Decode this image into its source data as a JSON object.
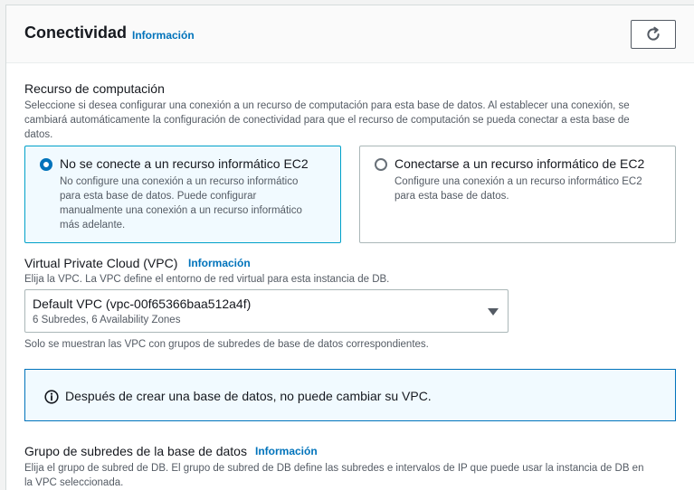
{
  "header": {
    "title": "Conectividad",
    "info_label": "Información",
    "refresh_icon": "refresh-icon"
  },
  "compute": {
    "label": "Recurso de computación",
    "description_lines": [
      "Seleccione si desea configurar una conexión a un recurso de computación para esta base de datos. Al establecer una conexión, se",
      "cambiará automáticamente la configuración de conectividad para que el recurso de computación se pueda conectar a esta base de",
      "datos."
    ],
    "options": [
      {
        "title": "No se conecte a un recurso informático EC2",
        "description_lines": [
          "No configure una conexión a un recurso informático",
          "para esta base de datos. Puede configurar",
          "manualmente una conexión a un recurso informático",
          "más adelante."
        ],
        "selected": true
      },
      {
        "title": "Conectarse a un recurso informático de EC2",
        "description_lines": [
          "Configure una conexión a un recurso informático EC2",
          "para esta base de datos."
        ],
        "selected": false
      }
    ]
  },
  "vpc": {
    "label": "Virtual Private Cloud (VPC)",
    "info_label": "Información",
    "description": "Elija la VPC. La VPC define el entorno de red virtual para esta instancia de DB.",
    "selected_value": "Default VPC (vpc-00f65366baa512a4f)",
    "selected_sub": "6 Subredes, 6 Availability Zones",
    "hint": "Solo se muestran las VPC con grupos de subredes de base de datos correspondientes."
  },
  "alert": {
    "icon": "info-icon",
    "text": "Después de crear una base de datos, no puede cambiar su VPC."
  },
  "subnet": {
    "label": "Grupo de subredes de la base de datos",
    "info_label": "Información",
    "description_lines": [
      "Elija el grupo de subred de DB. El grupo de subred de DB define las subredes e intervalos de IP que puede usar la instancia de DB en",
      "la VPC seleccionada."
    ]
  },
  "colors": {
    "accent": "#0073bb",
    "selected_border": "#00a1c9",
    "selected_bg": "#f1faff"
  }
}
